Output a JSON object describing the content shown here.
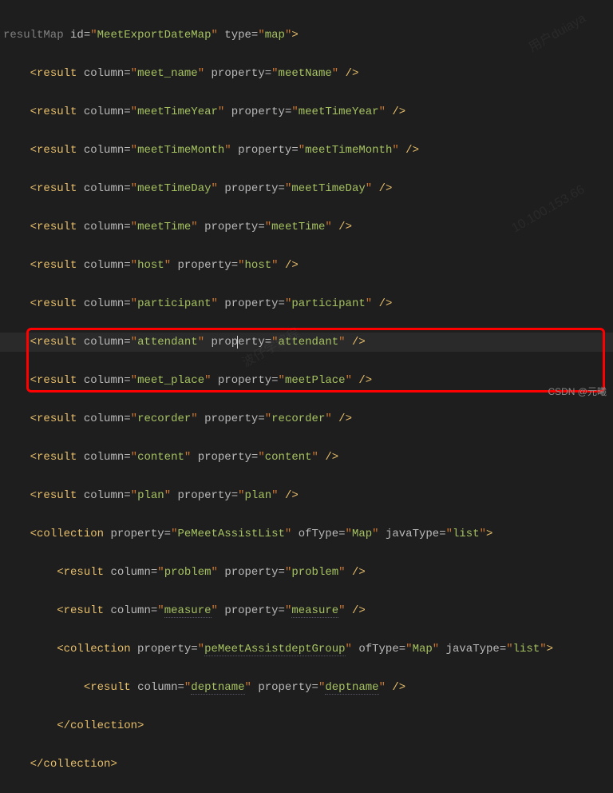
{
  "resultMap": {
    "id": "MeetExportDateMap",
    "type": "map"
  },
  "results": [
    {
      "column": "meet_name",
      "property": "meetName"
    },
    {
      "column": "meetTimeYear",
      "property": "meetTimeYear"
    },
    {
      "column": "meetTimeMonth",
      "property": "meetTimeMonth"
    },
    {
      "column": "meetTimeDay",
      "property": "meetTimeDay"
    },
    {
      "column": "meetTime",
      "property": "meetTime"
    },
    {
      "column": "host",
      "property": "host"
    },
    {
      "column": "participant",
      "property": "participant"
    },
    {
      "column": "attendant",
      "property": "attendant"
    },
    {
      "column": "meet_place",
      "property": "meetPlace"
    },
    {
      "column": "recorder",
      "property": "recorder"
    },
    {
      "column": "content",
      "property": "content"
    },
    {
      "column": "plan",
      "property": "plan"
    }
  ],
  "collection1": {
    "property": "PeMeetAssistList",
    "ofType": "Map",
    "javaType": "list"
  },
  "innerResults": [
    {
      "column": "problem",
      "property": "problem"
    },
    {
      "column": "measure",
      "property": "measure"
    }
  ],
  "collection2": {
    "property": "peMeetAssistdeptGroup",
    "ofType": "Map",
    "javaType": "list"
  },
  "deptResult": {
    "column": "deptname",
    "property": "deptname"
  },
  "closeCollection": "collection",
  "tags": {
    "result": "result",
    "collection": "collection",
    "resultMap": "resultMap"
  },
  "attrs": {
    "id": "id",
    "type": "type",
    "column": "column",
    "property": "property",
    "ofType": "ofType",
    "javaType": "javaType"
  },
  "attribution": "CSDN @元曦"
}
